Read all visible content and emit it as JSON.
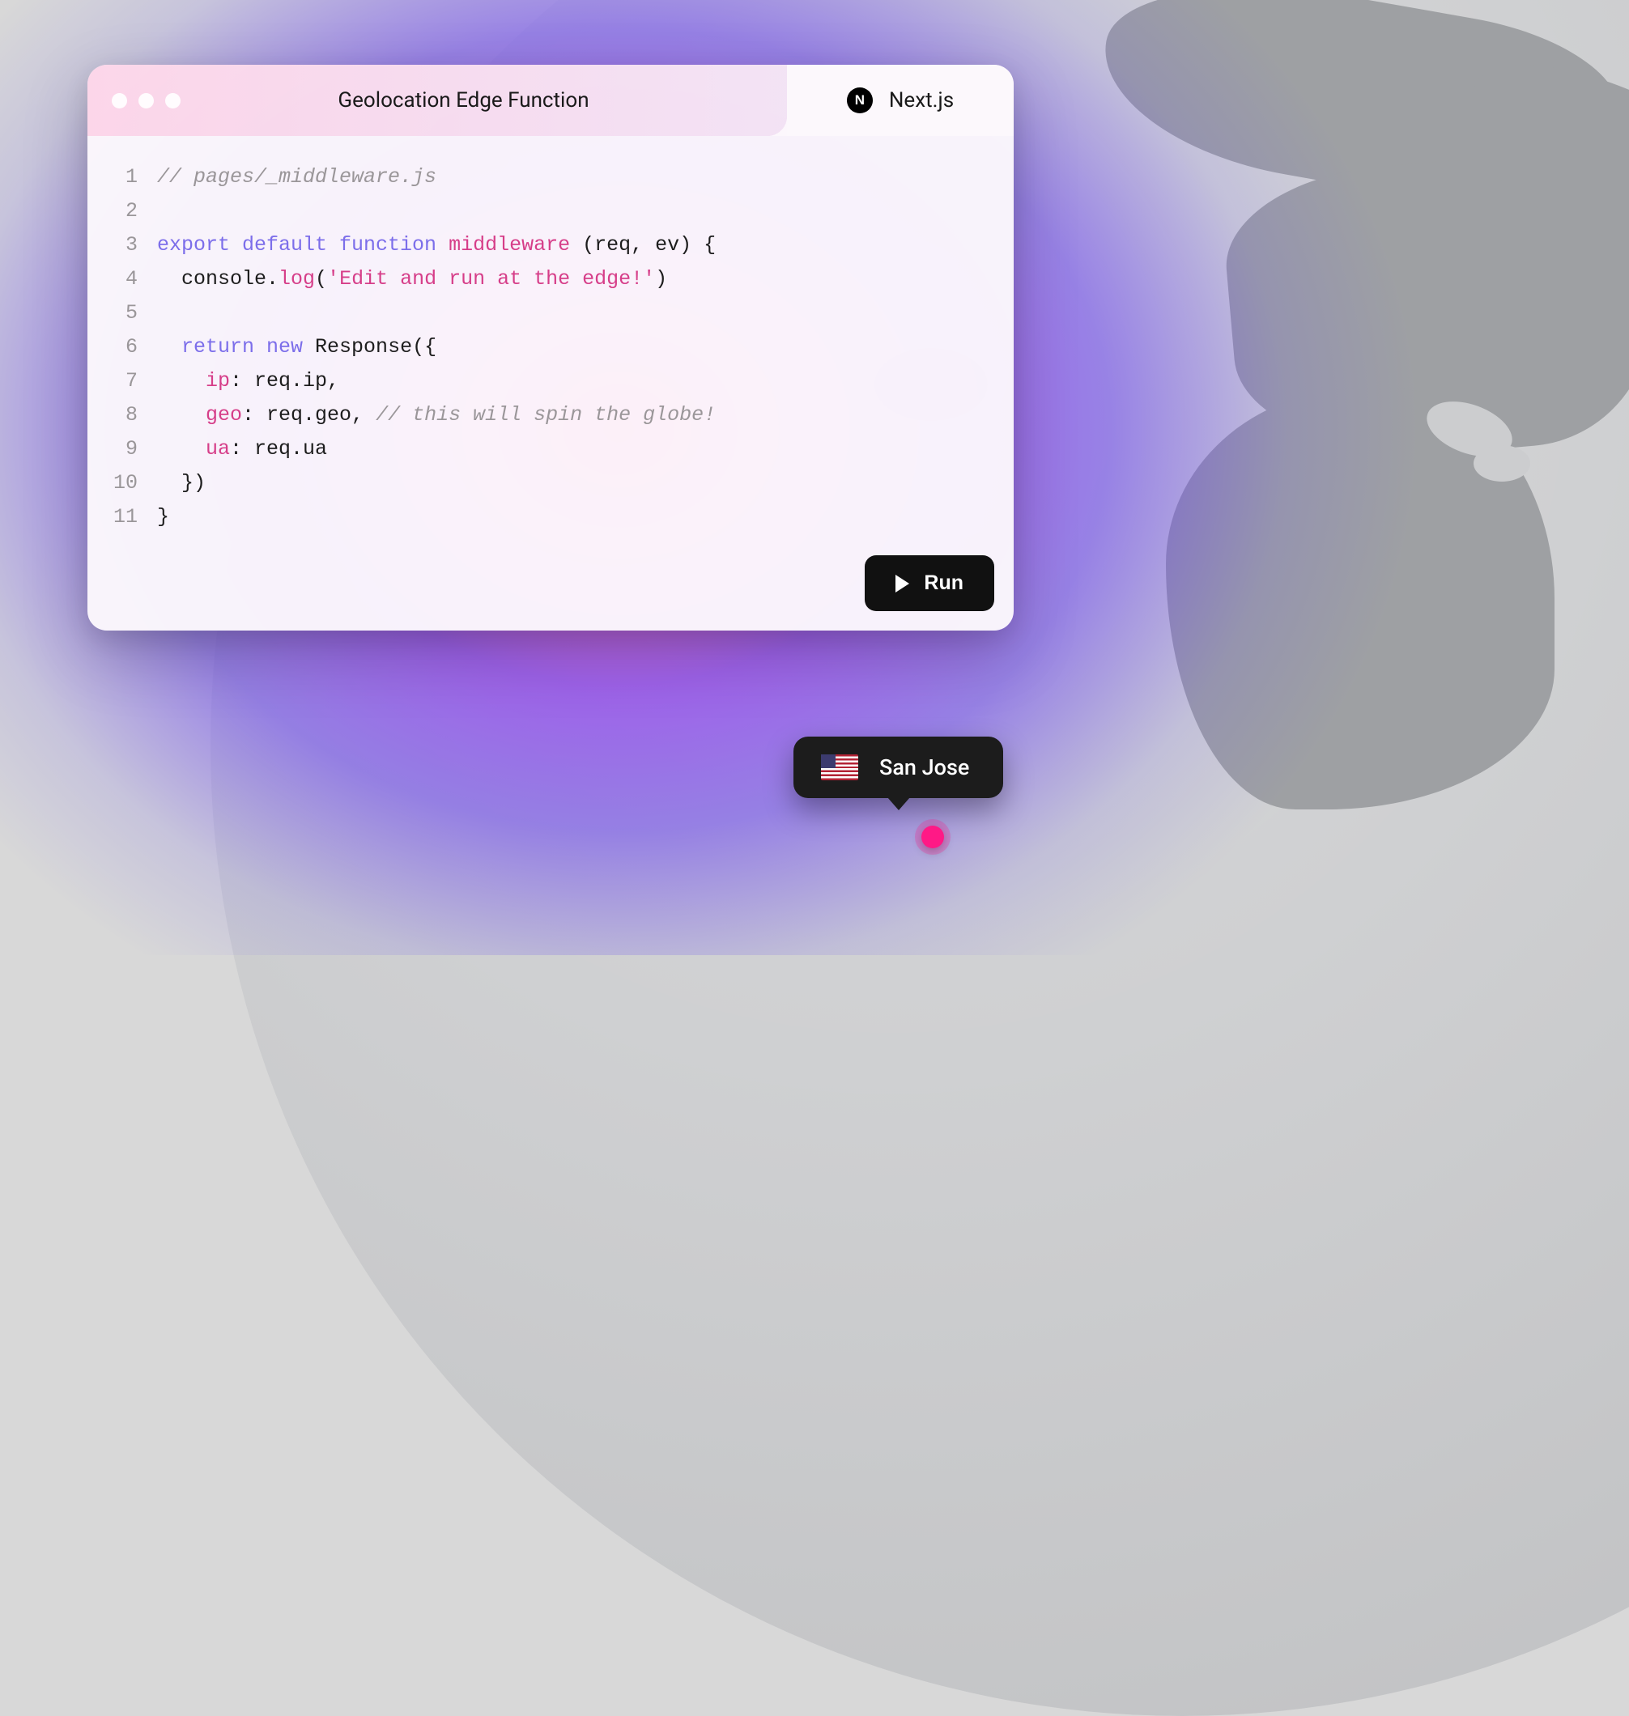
{
  "window": {
    "title": "Geolocation Edge Function",
    "framework": "Next.js",
    "framework_logo_letter": "N"
  },
  "code": {
    "line_count": 11,
    "lines": {
      "l1_comment": "// pages/_middleware.js",
      "l3_kw1": "export default function",
      "l3_fn": " middleware",
      "l3_rest": " (req, ev) {",
      "l4_indent": "  console.",
      "l4_fn": "log",
      "l4_paren_open": "(",
      "l4_string": "'Edit and run at the edge!'",
      "l4_paren_close": ")",
      "l6_indent": "  ",
      "l6_kw": "return new",
      "l6_rest": " Response({",
      "l7_indent": "    ",
      "l7_prop": "ip",
      "l7_rest": ": req.ip,",
      "l8_indent": "    ",
      "l8_prop": "geo",
      "l8_rest": ": req.geo, ",
      "l8_comment": "// this will spin the globe!",
      "l9_indent": "    ",
      "l9_prop": "ua",
      "l9_rest": ": req.ua",
      "l10": "  })",
      "l11": "}"
    }
  },
  "actions": {
    "run_label": "Run"
  },
  "location": {
    "city": "San Jose",
    "country_code": "US"
  },
  "colors": {
    "accent_pink": "#ff1986",
    "accent_purple": "#7c6eea",
    "string": "#d63e89"
  }
}
